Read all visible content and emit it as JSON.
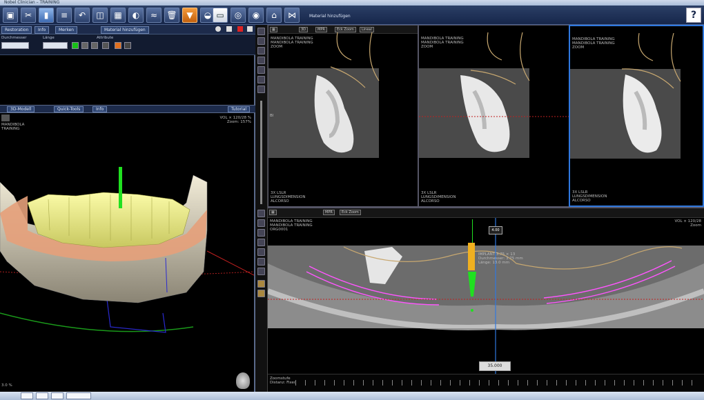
{
  "window": {
    "title": "Nobel Clinician – TRAINING"
  },
  "toolbar": {
    "material_label": "Material hinzufügen",
    "help_label": "?",
    "buttons": [
      "new-icon",
      "tools-icon",
      "scan-icon",
      "stack-icon",
      "undo-icon",
      "view-icon",
      "grid-icon",
      "bone-icon",
      "nerve-icon",
      "implant-icon",
      "trash-icon",
      "tooth-icon",
      "mask-icon",
      "layout-icon",
      "camera-icon",
      "save-icon",
      "share-icon"
    ]
  },
  "left_panel": {
    "tabs": [
      "Restoration",
      "Info",
      "Merken",
      "Material hinzufügen"
    ],
    "col_heads": [
      "Durchmesser",
      "Länge",
      "Attribute"
    ],
    "view_tabs": [
      "3D-Modell",
      "Quick-Tools",
      "Info"
    ],
    "tutorial_label": "Tutorial",
    "overlay_top_left": [
      "MANDIBOLA",
      "TRAINING"
    ],
    "overlay_top_right": [
      "VOL × 120/28 %",
      "Zoom: 157%"
    ],
    "overlay_bottom_left": "3.0 %"
  },
  "slice_panes": [
    {
      "name": "slice-left",
      "buttons": [
        "3D",
        "MPR",
        "Eck Zoom",
        "Lineal"
      ],
      "info": [
        "MANDIBOLA TRAINING",
        "MANDIBOLA TRAINING",
        "ZOOM"
      ],
      "footer": [
        "3X LSLR",
        "LUNGSDIMENSION",
        "ALCORSO"
      ],
      "marker": "Bl"
    },
    {
      "name": "slice-center",
      "buttons": [],
      "info": [
        "MANDIBOLA TRAINING",
        "MANDIBOLA TRAINING",
        "ZOOM"
      ],
      "footer": [
        "3X LSLR",
        "LUNGSDIMENSION",
        "ALCORSO"
      ],
      "marker": ""
    },
    {
      "name": "slice-right",
      "buttons": [],
      "info": [
        "MANDIBOLA TRAINING",
        "MANDIBOLA TRAINING",
        "ZOOM"
      ],
      "footer": [
        "3X LSLR",
        "LUNGSDIMENSION",
        "ALCORSO"
      ],
      "marker": ""
    }
  ],
  "pano": {
    "buttons": [
      "MPR",
      "Eck Zoom"
    ],
    "info": [
      "MANDIBOLA TRAINING",
      "MANDIBOLA TRAINING",
      "ORG0001"
    ],
    "info_right": [
      "VOL × 120/28",
      "Zoom"
    ],
    "implant_label": [
      "IMPLANT 3.75 × 13",
      "Durchmesser: 3.75 mm",
      "Länge: 13.0 mm"
    ],
    "value_box": "4.00",
    "bottom_value": "35.000",
    "ruler_label": [
      "Zoomstufe",
      "Distanz: Fixed"
    ]
  },
  "colors": {
    "accent": "#2f78e0",
    "implant": "#f0b020",
    "nerve": "#ff55ff",
    "prosthesis": "#f0f08a",
    "bone": "#e6e0cc"
  }
}
